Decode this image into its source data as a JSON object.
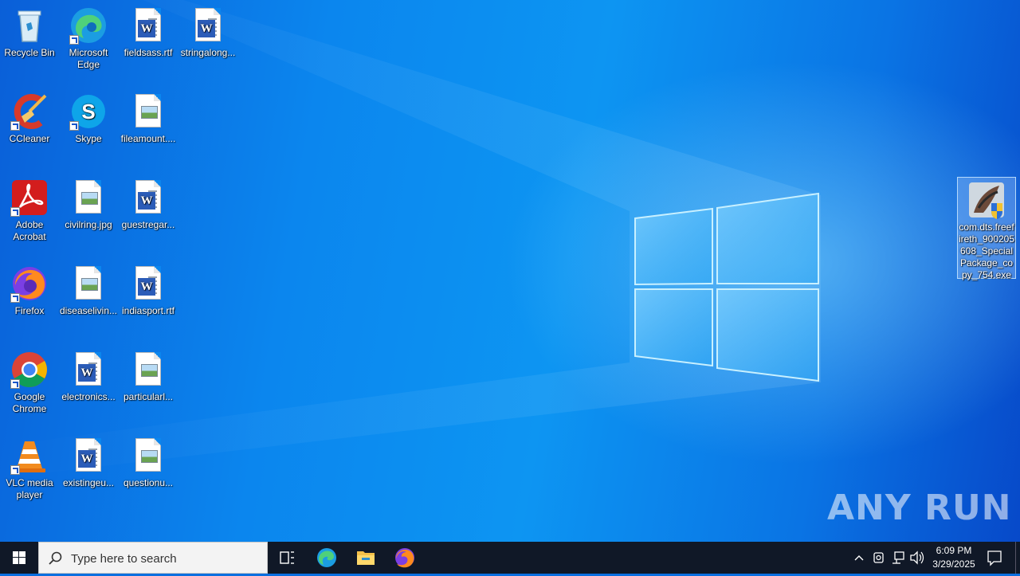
{
  "desktop": {
    "icons": [
      {
        "label": "Recycle Bin",
        "icon": "recycle-bin-icon"
      },
      {
        "label": "Microsoft Edge",
        "icon": "edge-icon"
      },
      {
        "label": "fieldsass.rtf",
        "icon": "word-document-icon"
      },
      {
        "label": "stringalong...",
        "icon": "word-document-icon"
      },
      {
        "label": "CCleaner",
        "icon": "ccleaner-icon"
      },
      {
        "label": "Skype",
        "icon": "skype-icon"
      },
      {
        "label": "fileamount....",
        "icon": "image-file-icon"
      },
      {
        "label": "Adobe Acrobat",
        "icon": "acrobat-icon"
      },
      {
        "label": "civilring.jpg",
        "icon": "image-file-icon"
      },
      {
        "label": "guestregar...",
        "icon": "word-document-icon"
      },
      {
        "label": "Firefox",
        "icon": "firefox-icon"
      },
      {
        "label": "diseaselivin...",
        "icon": "image-file-icon"
      },
      {
        "label": "indiasport.rtf",
        "icon": "word-document-icon"
      },
      {
        "label": "Google Chrome",
        "icon": "chrome-icon"
      },
      {
        "label": "electronics...",
        "icon": "word-document-icon"
      },
      {
        "label": "particularl...",
        "icon": "image-file-icon"
      },
      {
        "label": "VLC media player",
        "icon": "vlc-icon"
      },
      {
        "label": "existingeu...",
        "icon": "word-document-icon"
      },
      {
        "label": "questionu...",
        "icon": "image-file-icon"
      },
      {
        "label": "com.dts.freefireth_900205608_SpecialPackage_copy_754.exe",
        "icon": "exe-file-icon"
      }
    ]
  },
  "taskbar": {
    "search_placeholder": "Type here to search",
    "pinned": [
      "task-view-icon",
      "edge-icon",
      "file-explorer-icon",
      "firefox-icon"
    ],
    "tray_icons": [
      "chevron-up-icon",
      "meet-now-icon",
      "network-icon",
      "volume-icon"
    ],
    "clock": {
      "time": "6:09 PM",
      "date": "3/29/2025"
    },
    "notification_icon": "notification-icon"
  },
  "watermark": "ANY RUN",
  "colors": {
    "taskbar": "#101827",
    "wallpaper_accent": "#0b86ee",
    "selection": "#a0c8ff"
  }
}
